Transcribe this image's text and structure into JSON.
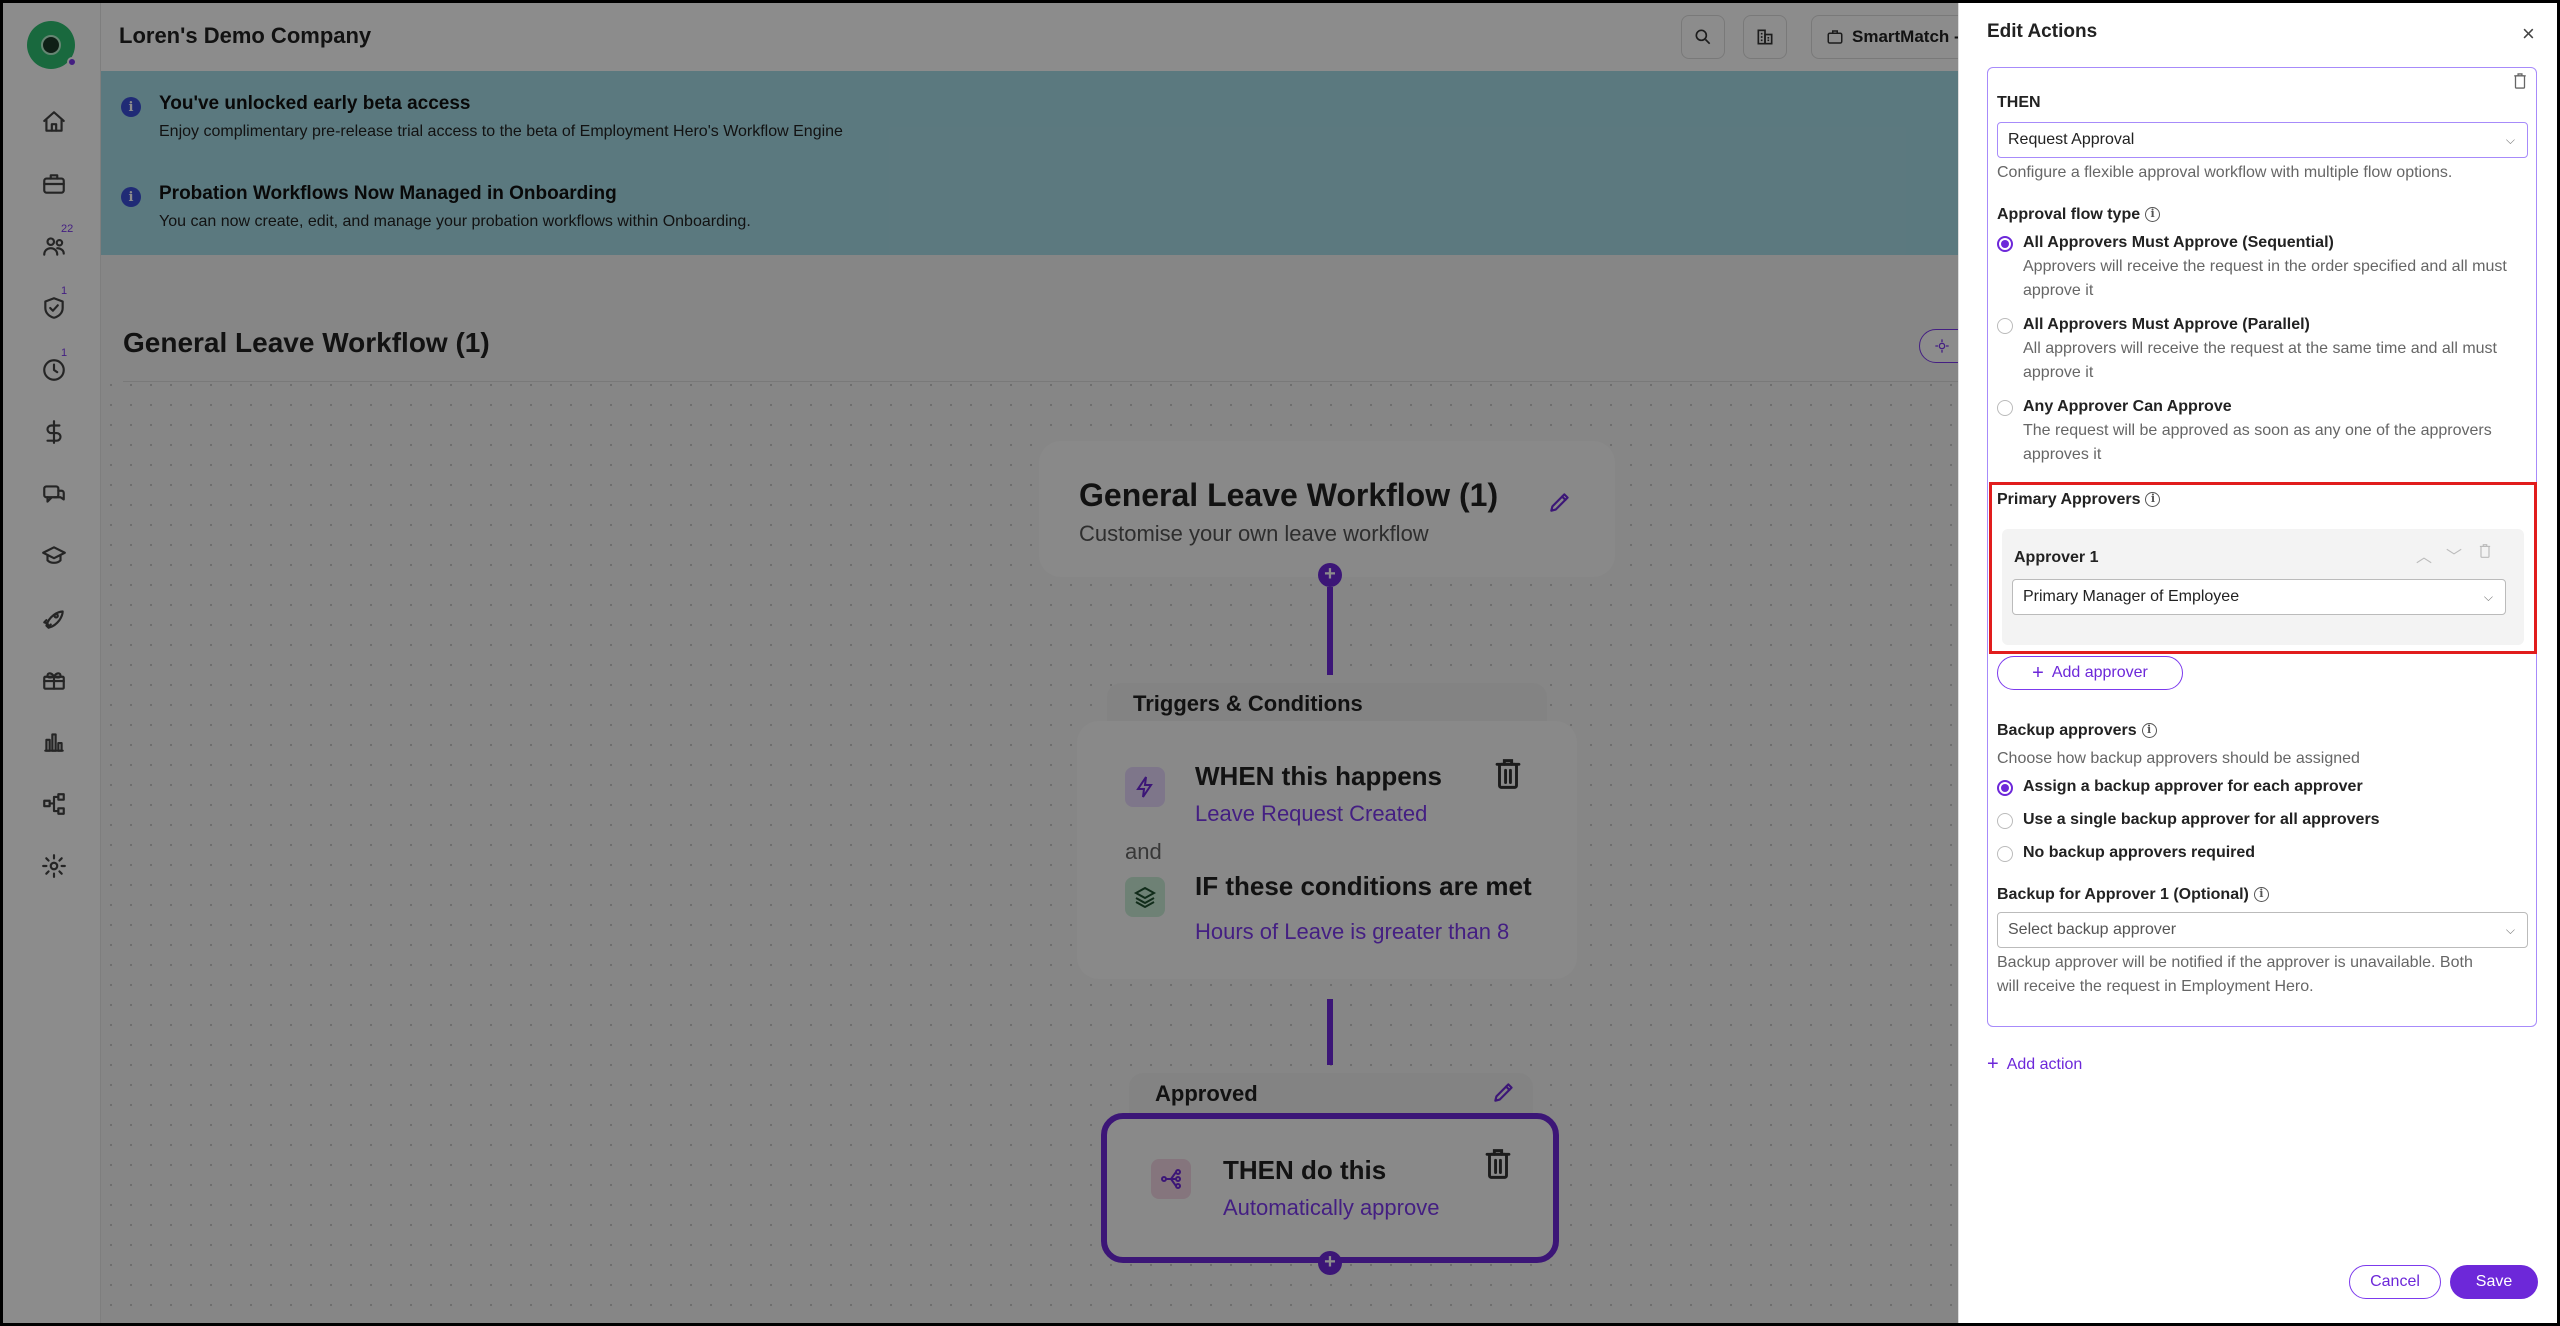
{
  "header": {
    "company_name": "Loren's Demo Company",
    "smartmatch_label": "SmartMatch -"
  },
  "sidebar": {
    "badges": {
      "team": "22",
      "compliance": "1",
      "time": "1"
    }
  },
  "banners": [
    {
      "title": "You've unlocked early beta access",
      "description": "Enjoy complimentary pre-release trial access to the beta of Employment Hero's Workflow Engine"
    },
    {
      "title": "Probation Workflows Now Managed in Onboarding",
      "description": "You can now create, edit, and manage your probation workflows within Onboarding."
    }
  ],
  "workspace": {
    "title": "General Leave Workflow (1)",
    "workflow_card": {
      "title": "General Leave Workflow (1)",
      "subtitle": "Customise your own leave workflow"
    },
    "triggers": {
      "header": "Triggers & Conditions",
      "when_title": "WHEN this happens",
      "when_value": "Leave Request Created",
      "and_label": "and",
      "if_title": "IF these conditions are met",
      "if_value": "Hours of Leave is greater than 8"
    },
    "approved": {
      "header": "Approved",
      "then_title": "THEN do this",
      "then_value": "Automatically approve"
    }
  },
  "panel": {
    "title": "Edit Actions",
    "close": "×",
    "then_label": "THEN",
    "action_value": "Request Approval",
    "action_desc": "Configure a flexible approval workflow with multiple flow options.",
    "flow_type_label": "Approval flow type",
    "flow_options": [
      {
        "title": "All Approvers Must Approve (Sequential)",
        "desc1": "Approvers will receive the request in the order specified and all must",
        "desc2": "approve it",
        "selected": true
      },
      {
        "title": "All Approvers Must Approve (Parallel)",
        "desc1": "All approvers will receive the request at the same time and all must",
        "desc2": "approve it",
        "selected": false
      },
      {
        "title": "Any Approver Can Approve",
        "desc1": "The request will be approved as soon as any one of the approvers",
        "desc2": "approves it",
        "selected": false
      }
    ],
    "primary_label": "Primary Approvers",
    "approver_label": "Approver 1",
    "approver_value": "Primary Manager of Employee",
    "add_approver": "Add approver",
    "backup_label": "Backup approvers",
    "backup_desc": "Choose how backup approvers should be assigned",
    "backup_options": [
      {
        "label": "Assign a backup approver for each approver",
        "selected": true
      },
      {
        "label": "Use a single backup approver for all approvers",
        "selected": false
      },
      {
        "label": "No backup approvers required",
        "selected": false
      }
    ],
    "backup_for_label": "Backup for Approver 1 (Optional)",
    "backup_placeholder": "Select backup approver",
    "backup_note1": "Backup approver will be notified if the approver is unavailable. Both",
    "backup_note2": "will receive the request in Employment Hero.",
    "add_action": "Add action",
    "cancel": "Cancel",
    "save": "Save"
  },
  "colors": {
    "accent": "#6d28d9",
    "highlight": "#e11d1d",
    "banner": "#a7dde8"
  }
}
